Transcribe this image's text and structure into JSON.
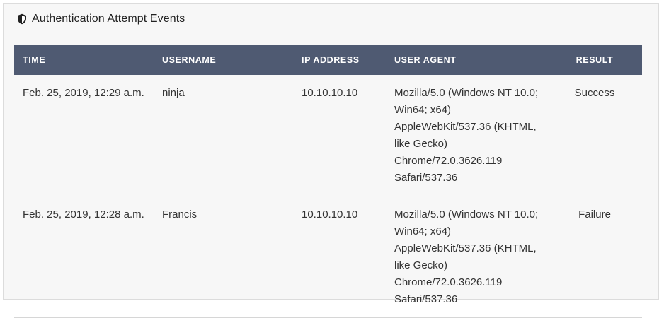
{
  "panel": {
    "title": "Authentication Attempt Events",
    "icon": "shield-icon"
  },
  "table": {
    "headers": {
      "time": "TIME",
      "username": "USERNAME",
      "ip": "IP ADDRESS",
      "user_agent": "USER AGENT",
      "result": "RESULT"
    },
    "rows": [
      {
        "time": "Feb. 25, 2019, 12:29 a.m.",
        "username": "ninja",
        "ip": "10.10.10.10",
        "user_agent": "Mozilla/5.0 (Windows NT 10.0; Win64; x64) AppleWebKit/537.36 (KHTML, like Gecko) Chrome/72.0.3626.119 Safari/537.36",
        "result": "Success"
      },
      {
        "time": "Feb. 25, 2019, 12:28 a.m.",
        "username": "Francis",
        "ip": "10.10.10.10",
        "user_agent": "Mozilla/5.0 (Windows NT 10.0; Win64; x64) AppleWebKit/537.36 (KHTML, like Gecko) Chrome/72.0.3626.119 Safari/537.36",
        "result": "Failure"
      }
    ]
  }
}
